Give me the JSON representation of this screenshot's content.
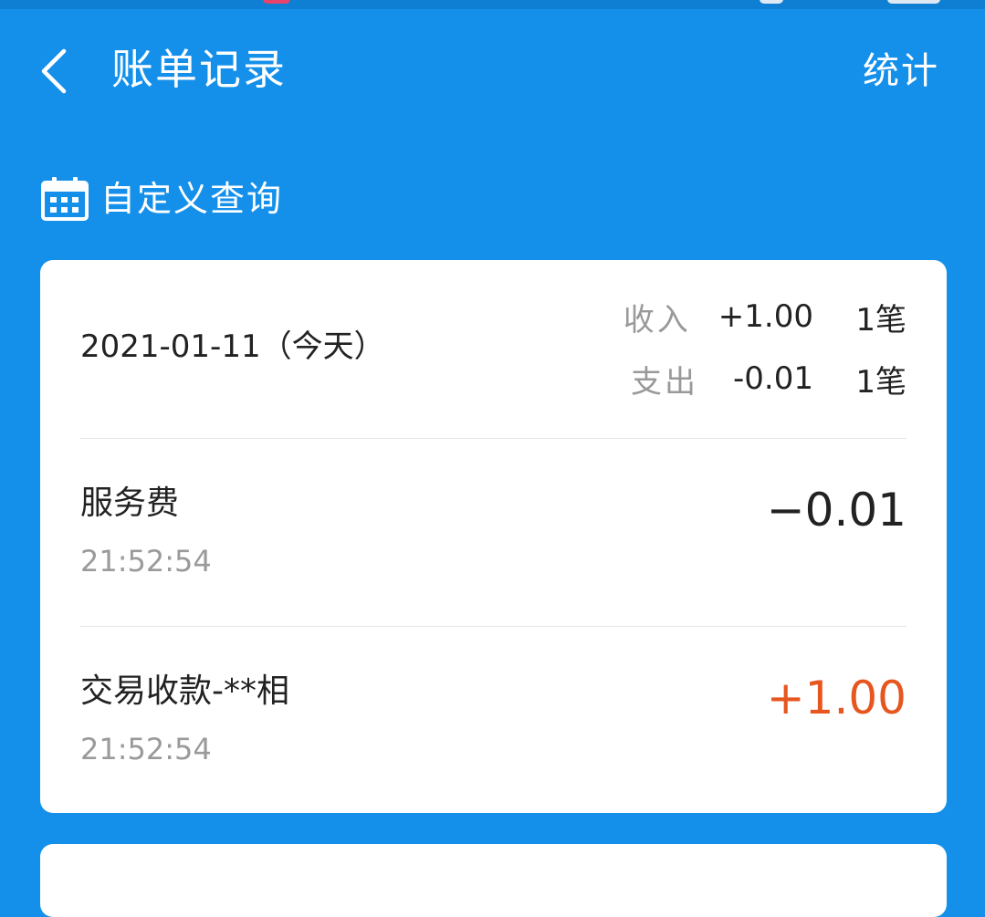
{
  "header": {
    "title": "账单记录",
    "stats_label": "统计"
  },
  "filter": {
    "custom_query_label": "自定义查询"
  },
  "day_group": {
    "date": "2021-01-11（今天）",
    "income": {
      "label": "收入",
      "amount": "+1.00",
      "count": "1笔"
    },
    "expense": {
      "label": "支出",
      "amount": "-0.01",
      "count": "1笔"
    },
    "transactions": [
      {
        "title": "服务费",
        "time": "21:52:54",
        "amount": "−0.01"
      },
      {
        "title": "交易收款-**相",
        "time": "21:52:54",
        "amount": "+1.00"
      }
    ]
  },
  "colors": {
    "primary_blue": "#1590EA",
    "income_orange": "#E6561F",
    "text_dark": "#222222",
    "text_muted": "#999999"
  },
  "icons": {
    "back": "chevron-left-icon",
    "calendar": "calendar-icon"
  }
}
